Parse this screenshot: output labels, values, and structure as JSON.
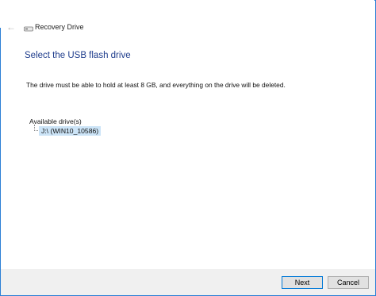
{
  "window": {
    "title": "Recovery Drive",
    "back_icon": "back-arrow-icon",
    "drive_icon": "usb-drive-icon",
    "border_color": "#2b7fd6"
  },
  "main": {
    "heading": "Select the USB flash drive",
    "instruction": "The drive must be able to hold at least 8 GB, and everything on the drive will be deleted.",
    "available_label": "Available drive(s)",
    "drives": [
      {
        "label": "J:\\ (WIN10_10586)",
        "selected": true
      }
    ]
  },
  "footer": {
    "next_label": "Next",
    "cancel_label": "Cancel"
  },
  "colors": {
    "heading": "#1e3c8c",
    "selection": "#cce4f7",
    "footer_bg": "#f0f0f0"
  }
}
